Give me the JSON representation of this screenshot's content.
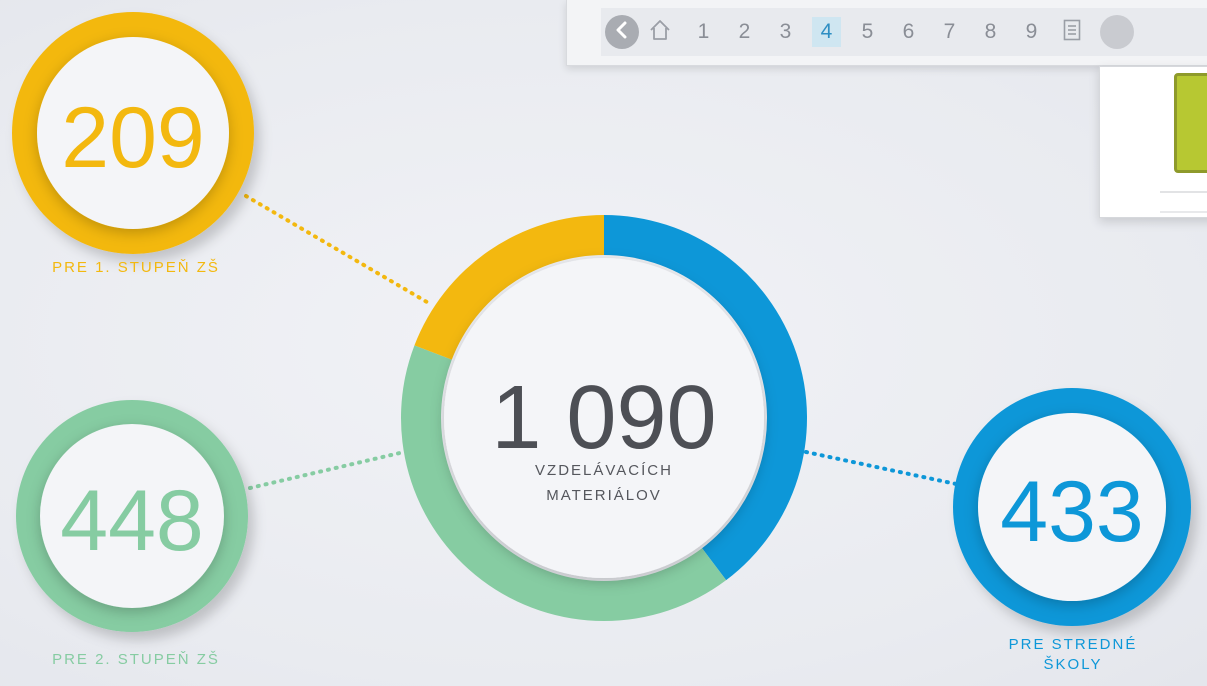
{
  "toolbar": {
    "pages": [
      "1",
      "2",
      "3",
      "4",
      "5",
      "6",
      "7",
      "8",
      "9"
    ],
    "active_page": "4",
    "icons": [
      "chevron-left-icon",
      "home-icon",
      "document-list-icon"
    ]
  },
  "colors": {
    "yellow": "#f3b80f",
    "green": "#86cca2",
    "blue": "#0d97d8",
    "text_dark": "#4d4f55"
  },
  "chart_data": {
    "type": "donut",
    "total": {
      "value": "1 090",
      "label_line1": "VZDELÁVACÍCH",
      "label_line2": "MATERIÁLOV"
    },
    "segments": [
      {
        "name": "PRE 1. STUPEŇ ZŠ",
        "value": 209,
        "value_text": "209",
        "color": "#f3b80f"
      },
      {
        "name": "PRE 2. STUPEŇ ZŠ",
        "value": 448,
        "value_text": "448",
        "color": "#86cca2"
      },
      {
        "name_line1": "PRE STREDNÉ",
        "name_line2": "ŠKOLY",
        "value": 433,
        "value_text": "433",
        "color": "#0d97d8"
      }
    ]
  }
}
